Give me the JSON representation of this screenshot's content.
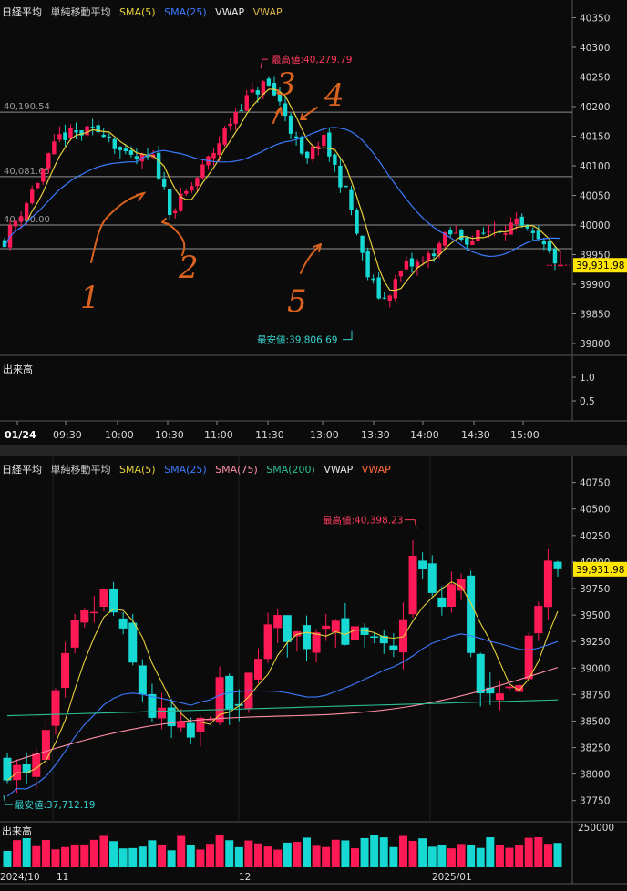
{
  "colors": {
    "up": "#ff1a55",
    "down": "#17d9d4",
    "sma5": "#e6d13a",
    "sma25": "#3b7bff",
    "sma75": "#ff8fa6",
    "sma200": "#2bbf94",
    "vwap": "#e8e8e8",
    "vwap2": "#d9b54a",
    "grid": "#2a2a2a",
    "white": "#ffffff",
    "label_max": "#ff3a5c",
    "label_min": "#36d3d0",
    "annot": "#d9621e",
    "price_tag": "#ffe600"
  },
  "intraday": {
    "legend": {
      "name": "日経平均",
      "indicator": "単純移動平均",
      "sma5": "SMA(5)",
      "sma25": "SMA(25)",
      "vwap": "VWAP",
      "vwap2": "VWAP"
    },
    "volume_label": "出来高",
    "high_label": "最高値:40,279.79",
    "low_label": "最安値:39,806.69",
    "price_tag": "39,931.98",
    "annotations": [
      "1",
      "2",
      "3",
      "4",
      "5"
    ],
    "chart_data": {
      "type": "candlestick",
      "y_ticks": [
        "40350",
        "40300",
        "40250",
        "40200",
        "40150",
        "40100",
        "40050",
        "40000",
        "39950",
        "39900",
        "39850",
        "39800"
      ],
      "vol_ticks": [
        "1.0",
        "0.5"
      ],
      "x_ticks": [
        "01/24",
        "09:30",
        "10:00",
        "10:30",
        "11:00",
        "11:30",
        "13:00",
        "13:30",
        "14:00",
        "14:30",
        "15:00"
      ],
      "ylim": [
        39780,
        40380
      ],
      "levels": [
        {
          "value": 40190.54,
          "label": "40,190.54"
        },
        {
          "value": 40081.65,
          "label": "40,081.65"
        },
        {
          "value": 40000,
          "label": "40,000.00"
        },
        {
          "value": 39960,
          "label": ""
        }
      ],
      "last": 39931.98,
      "high": 40279.79,
      "low": 39806.69
    }
  },
  "daily": {
    "legend": {
      "name": "日経平均",
      "indicator": "単純移動平均",
      "sma5": "SMA(5)",
      "sma25": "SMA(25)",
      "sma75": "SMA(75)",
      "sma200": "SMA(200)",
      "vwap": "VWAP",
      "vwap2": "VWAP"
    },
    "volume_label": "出来高",
    "high_label": "最高値:40,398.23",
    "low_label": "最安値:37,712.19",
    "price_tag": "39,931.98",
    "chart_data": {
      "type": "candlestick",
      "y_ticks": [
        "40750",
        "40500",
        "40250",
        "40000",
        "39750",
        "39500",
        "39250",
        "39000",
        "38750",
        "38500",
        "38250",
        "38000",
        "37750"
      ],
      "vol_ticks": [
        "250000"
      ],
      "x_ticks": [
        "2024/10",
        "11",
        "12",
        "2025/01"
      ],
      "ylim": [
        37550,
        40850
      ],
      "last": 39931.98,
      "high": 40398.23,
      "low": 37712.19
    }
  }
}
